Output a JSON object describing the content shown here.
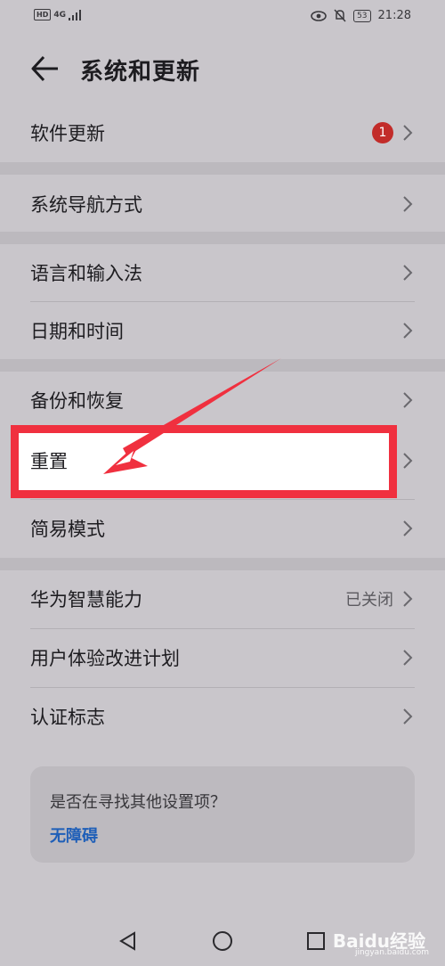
{
  "status_bar": {
    "hd": "HD",
    "network": "4G",
    "battery": "53",
    "time": "21:28"
  },
  "header": {
    "title": "系统和更新"
  },
  "rows": {
    "software_update": {
      "label": "软件更新",
      "badge": "1"
    },
    "nav_method": {
      "label": "系统导航方式"
    },
    "language": {
      "label": "语言和输入法"
    },
    "datetime": {
      "label": "日期和时间"
    },
    "backup": {
      "label": "备份和恢复"
    },
    "reset": {
      "label": "重置"
    },
    "simple_mode": {
      "label": "简易模式"
    },
    "huawei_ai": {
      "label": "华为智慧能力",
      "value": "已关闭"
    },
    "ux_plan": {
      "label": "用户体验改进计划"
    },
    "cert": {
      "label": "认证标志"
    }
  },
  "suggestion_card": {
    "question": "是否在寻找其他设置项？",
    "link": "无障碍"
  },
  "watermark": {
    "text": "Baidu经验",
    "sub": "jingyan.baidu.com"
  },
  "colors": {
    "background": "#c9c6cb",
    "highlight_border": "#f0303f",
    "arrow": "#f0303f",
    "badge": "#c22c2a",
    "link": "#1f5fb8"
  }
}
